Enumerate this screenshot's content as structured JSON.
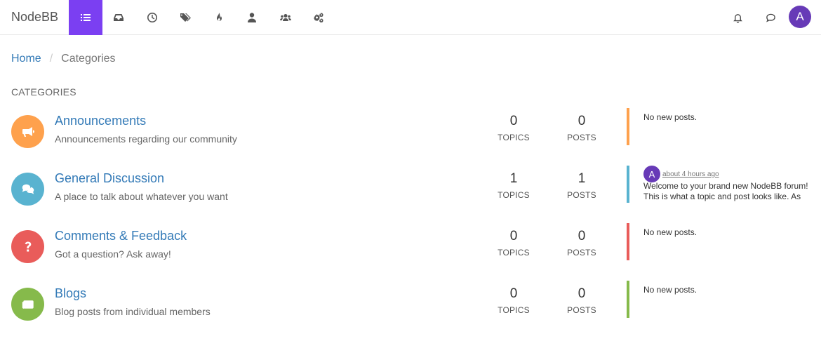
{
  "brand": "NodeBB",
  "nav": [
    {
      "name": "categories",
      "icon": "list-icon",
      "active": true
    },
    {
      "name": "unread",
      "icon": "inbox-icon"
    },
    {
      "name": "recent",
      "icon": "clock-icon"
    },
    {
      "name": "tags",
      "icon": "tags-icon"
    },
    {
      "name": "popular",
      "icon": "fire-icon"
    },
    {
      "name": "users",
      "icon": "user-icon"
    },
    {
      "name": "groups",
      "icon": "users-group-icon"
    },
    {
      "name": "admin",
      "icon": "cogs-icon"
    }
  ],
  "right_icons": [
    "bell-icon",
    "chat-icon"
  ],
  "user_avatar": "A",
  "colors": {
    "accent": "#7b3ff2",
    "link": "#337ab7",
    "avatar": "#673ab7"
  },
  "breadcrumb": {
    "home": "Home",
    "separator": "/",
    "current": "Categories"
  },
  "section_title": "CATEGORIES",
  "categories": [
    {
      "name": "Announcements",
      "description": "Announcements regarding our community",
      "icon": "bullhorn-icon",
      "color": "#fea14d",
      "topics": "0",
      "topics_label": "TOPICS",
      "posts": "0",
      "posts_label": "POSTS",
      "teaser": "No new posts."
    },
    {
      "name": "General Discussion",
      "description": "A place to talk about whatever you want",
      "icon": "comments-icon",
      "color": "#59b3d0",
      "topics": "1",
      "topics_label": "TOPICS",
      "posts": "1",
      "posts_label": "POSTS",
      "teaser_avatar": "A",
      "teaser_time": "about 4 hours ago",
      "teaser_text": "Welcome to your brand new NodeBB forum! This is what a topic and post looks like. As an administrator, you can edit the post's title and content."
    },
    {
      "name": "Comments & Feedback",
      "description": "Got a question? Ask away!",
      "icon": "question-icon",
      "color": "#e95c5a",
      "topics": "0",
      "topics_label": "TOPICS",
      "posts": "0",
      "posts_label": "POSTS",
      "teaser": "No new posts."
    },
    {
      "name": "Blogs",
      "description": "Blog posts from individual members",
      "icon": "newspaper-icon",
      "color": "#86ba4b",
      "topics": "0",
      "topics_label": "TOPICS",
      "posts": "0",
      "posts_label": "POSTS",
      "teaser": "No new posts."
    }
  ]
}
